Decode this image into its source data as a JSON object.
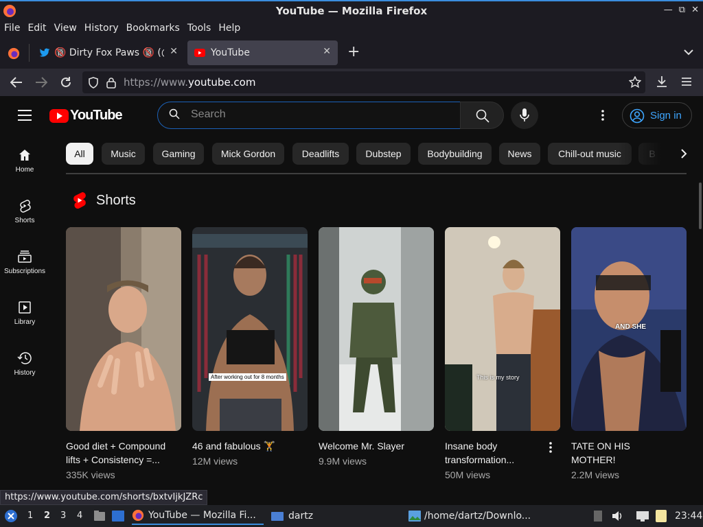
{
  "window": {
    "title": "YouTube — Mozilla Firefox"
  },
  "menu": [
    "File",
    "Edit",
    "View",
    "History",
    "Bookmarks",
    "Tools",
    "Help"
  ],
  "tabs": [
    {
      "title": "🔞 Dirty Fox Paws 🔞 (@fox",
      "close": "✕"
    },
    {
      "title": "YouTube",
      "close": "✕"
    }
  ],
  "new_tab": "+",
  "url": {
    "prefix": "https://www.",
    "domain": "youtube.com"
  },
  "youtube": {
    "wordmark": "YouTube",
    "search_placeholder": "Search",
    "sign_in": "Sign in",
    "sidebar": [
      {
        "label": "Home",
        "icon": "home-icon"
      },
      {
        "label": "Shorts",
        "icon": "shorts-icon"
      },
      {
        "label": "Subscriptions",
        "icon": "subscriptions-icon"
      },
      {
        "label": "Library",
        "icon": "library-icon"
      },
      {
        "label": "History",
        "icon": "history-icon"
      }
    ],
    "chips": [
      "All",
      "Music",
      "Gaming",
      "Mick Gordon",
      "Deadlifts",
      "Dubstep",
      "Bodybuilding",
      "News",
      "Chill-out music",
      "B"
    ],
    "shorts_heading": "Shorts",
    "shorts": [
      {
        "title": "Good diet + Compound lifts + Consistency =...",
        "views": "335K views"
      },
      {
        "title": "46 and fabulous 🏋️",
        "views": "12M views",
        "overlay": "After working out for 8 months"
      },
      {
        "title": "Welcome Mr. Slayer",
        "views": "9.9M views"
      },
      {
        "title": "Insane body transformation...",
        "views": "50M views",
        "overlay": "This is my story"
      },
      {
        "title": "TATE ON HIS MOTHER!",
        "views": "2.2M views",
        "overlay": "AND SHE"
      }
    ]
  },
  "status_url": "https://www.youtube.com/shorts/bxtvIjkJZRc",
  "taskbar": {
    "workspaces": [
      "1",
      "2",
      "3",
      "4"
    ],
    "tasks": [
      "YouTube — Mozilla Fi...",
      "dartz",
      "/home/dartz/Downlo..."
    ],
    "clock": "23:44"
  },
  "colors": {
    "accent": "#3ea6ff",
    "yt_red": "#ff0000",
    "bg": "#0f0f0f"
  }
}
